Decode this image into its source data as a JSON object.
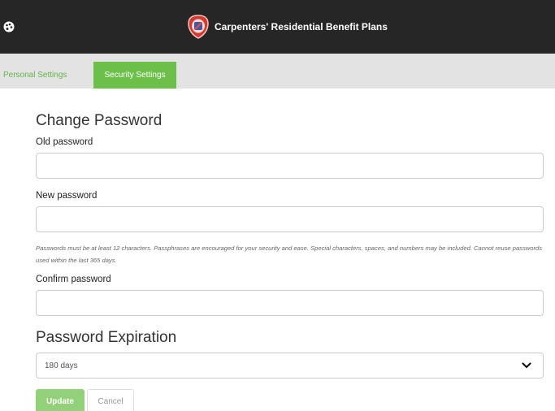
{
  "header": {
    "title": "Carpenters' Residential Benefit Plans",
    "left_icon": "palette-icon",
    "logo_icon": "union-shield-logo",
    "colors": {
      "bar": "#262626",
      "logo_red": "#d23b2e"
    }
  },
  "tabs": [
    {
      "label": "Personal Settings",
      "active": false
    },
    {
      "label": "Security Settings",
      "active": true
    }
  ],
  "accent_color": "#6cc04a",
  "change_password": {
    "heading": "Change Password",
    "old_label": "Old password",
    "old_value": "",
    "new_label": "New password",
    "new_value": "",
    "hint": "Passwords must be at least 12 characters. Passphrases are encouraged for your security and ease. Special characters, spaces, and numbers may be included. Cannot reuse passwords used within the last 365 days.",
    "confirm_label": "Confirm password",
    "confirm_value": ""
  },
  "password_expiration": {
    "heading": "Password Expiration",
    "selected": "180 days",
    "dropdown_icon": "chevron-down-icon"
  },
  "actions": {
    "update_label": "Update",
    "cancel_label": "Cancel"
  }
}
